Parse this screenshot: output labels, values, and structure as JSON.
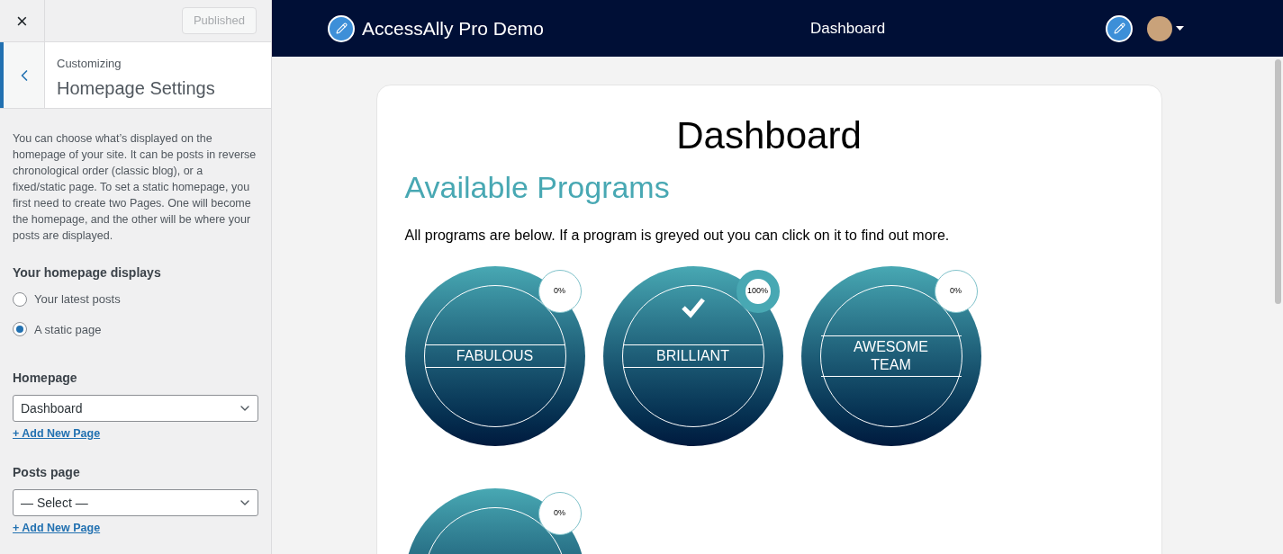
{
  "sidebar": {
    "close_icon": "×",
    "publish_button": "Published",
    "section_label": "Customizing",
    "section_title": "Homepage Settings",
    "description": "You can choose what’s displayed on the homepage of your site. It can be posts in reverse chronological order (classic blog), or a fixed/static page. To set a static homepage, you first need to create two Pages. One will become the homepage, and the other will be where your posts are displayed.",
    "displays_label": "Your homepage displays",
    "radios": [
      {
        "label": "Your latest posts",
        "selected": false
      },
      {
        "label": "A static page",
        "selected": true
      }
    ],
    "selects": [
      {
        "label": "Homepage",
        "value": "Dashboard",
        "link": "+ Add New Page"
      },
      {
        "label": "Posts page",
        "value": "— Select —",
        "link": "+ Add New Page"
      }
    ]
  },
  "header": {
    "site_title": "AccessAlly Pro Demo",
    "nav_item": "Dashboard"
  },
  "content": {
    "title": "Dashboard",
    "subtitle": "Available Programs",
    "intro": "All programs are below. If a program is greyed out you can click on it to find out more.",
    "programs": [
      {
        "name": "FABULOUS",
        "progress": "0%",
        "completed": false
      },
      {
        "name": "BRILLIANT",
        "progress": "100%",
        "completed": true
      },
      {
        "name": "AWESOME TEAM",
        "progress": "0%",
        "completed": false
      },
      {
        "progress": "0%",
        "completed": false
      }
    ]
  }
}
